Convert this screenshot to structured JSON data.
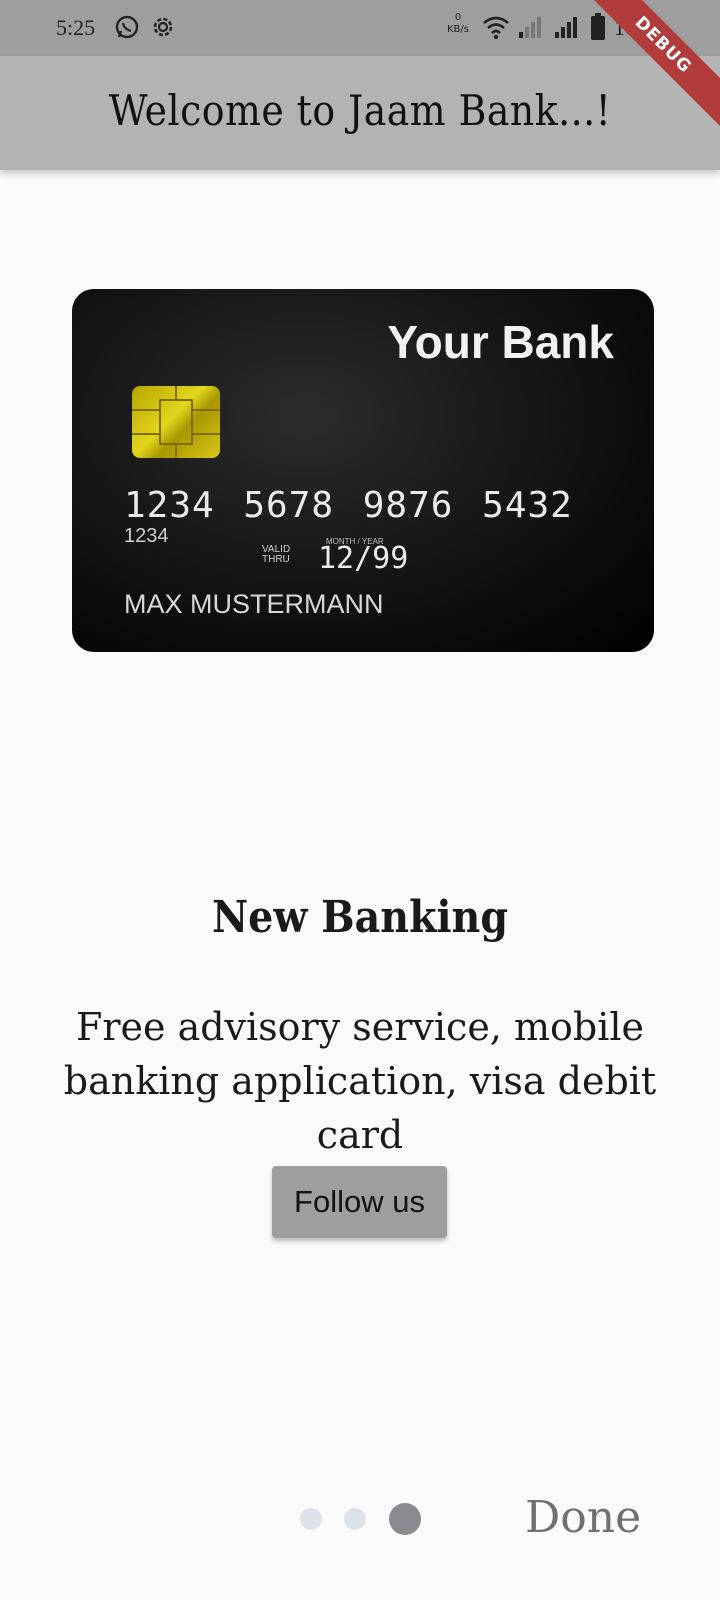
{
  "status_bar": {
    "time": "5:25",
    "network_speed_value": "0",
    "network_speed_unit": "KB/s",
    "battery": "100%",
    "icons": [
      "whatsapp-icon",
      "settings-icon",
      "wifi-icon",
      "signal-icon",
      "signal-icon",
      "battery-icon"
    ]
  },
  "debug_banner": {
    "label": "DEBUG"
  },
  "app_bar": {
    "title": "Welcome to Jaam Bank...!"
  },
  "card": {
    "bank_name": "Your Bank",
    "number": "1234 5678 9876 5432",
    "sub_number": "1234",
    "valid_label": "VALID THRU",
    "month_year_label": "MONTH / YEAR",
    "valid_date": "12/99",
    "holder": "MAX MUSTERMANN"
  },
  "slide": {
    "title": "New Banking",
    "description": "Free advisory service, mobile banking application, visa debit card",
    "button_label": "Follow us"
  },
  "pager": {
    "page_count": 3,
    "current_page": 3,
    "done_label": "Done"
  },
  "colors": {
    "status_bar": "#9e9e9e",
    "app_bar": "#b3b3b3",
    "background": "#fafafa",
    "button": "#9e9e9e",
    "dot_inactive": "#dde1e8",
    "dot_active": "#8a8a90",
    "debug": "#b23b3b"
  }
}
